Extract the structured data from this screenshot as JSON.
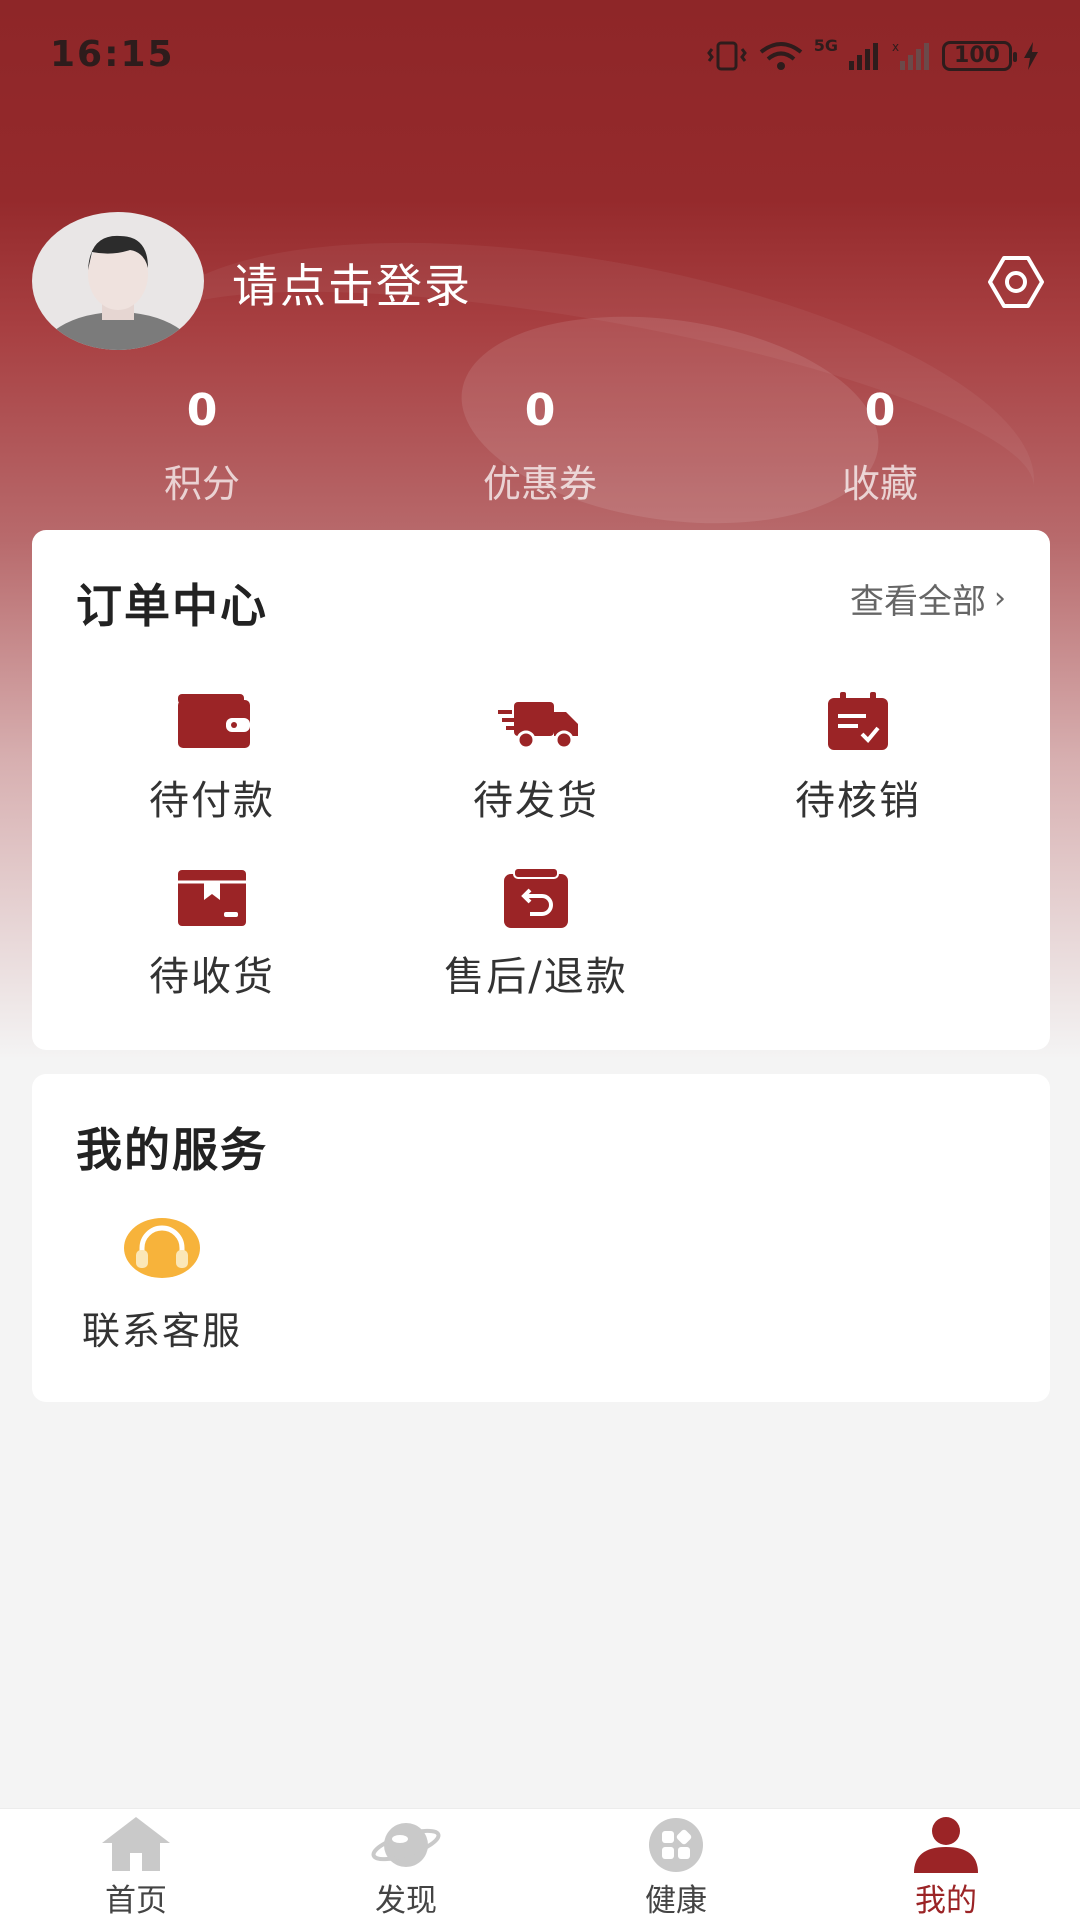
{
  "status_bar": {
    "time": "16:15",
    "signal_label": "5G",
    "battery": "100"
  },
  "profile": {
    "login_prompt": "请点击登录",
    "avatar_icon": "user-avatar",
    "settings_icon": "gear-icon"
  },
  "stats": [
    {
      "value": "0",
      "label": "积分"
    },
    {
      "value": "0",
      "label": "优惠券"
    },
    {
      "value": "0",
      "label": "收藏"
    }
  ],
  "orders": {
    "title": "订单中心",
    "view_all": "查看全部",
    "items": [
      {
        "label": "待付款",
        "icon": "wallet-icon"
      },
      {
        "label": "待发货",
        "icon": "truck-icon"
      },
      {
        "label": "待核销",
        "icon": "calendar-check-icon"
      },
      {
        "label": "待收货",
        "icon": "box-icon"
      },
      {
        "label": "售后/退款",
        "icon": "return-icon"
      }
    ]
  },
  "services": {
    "title": "我的服务",
    "items": [
      {
        "label": "联系客服",
        "icon": "headset-icon"
      }
    ]
  },
  "nav": {
    "items": [
      {
        "label": "首页",
        "icon": "home-icon",
        "active": false
      },
      {
        "label": "发现",
        "icon": "planet-icon",
        "active": false
      },
      {
        "label": "健康",
        "icon": "grid-icon",
        "active": false
      },
      {
        "label": "我的",
        "icon": "user-icon",
        "active": true
      }
    ]
  },
  "colors": {
    "brand": "#9b2426",
    "accent_icon": "#9b2426",
    "service_icon": "#f7b33b"
  }
}
